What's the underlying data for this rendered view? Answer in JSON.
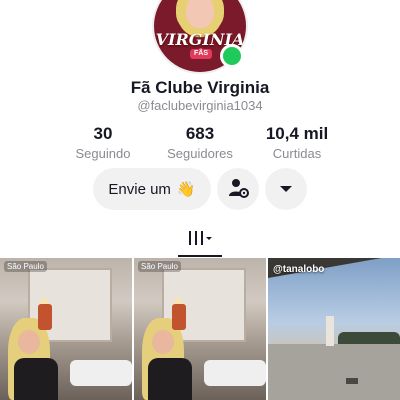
{
  "profile": {
    "display_name": "Fã Clube Virginia",
    "username": "@faclubevirginia1034",
    "avatar_brand": "VIRGINIA",
    "avatar_sub": "FÃS"
  },
  "stats": [
    {
      "value": "30",
      "label": "Seguindo"
    },
    {
      "value": "683",
      "label": "Seguidores"
    },
    {
      "value": "10,4 mil",
      "label": "Curtidas"
    }
  ],
  "actions": {
    "message_label": "Envie um",
    "message_emoji": "👋",
    "add_friend_icon": "person-settings-icon",
    "more_icon": "caret-down-icon"
  },
  "tabs": {
    "active_icon": "grid-bars-icon"
  },
  "videos": [
    {
      "location": "São Paulo"
    },
    {
      "location": "São Paulo"
    },
    {
      "mention": "@tanalobo"
    }
  ],
  "colors": {
    "online": "#20c95a",
    "button_bg": "#f1f1f2",
    "secondary_text": "#8a8b91"
  }
}
